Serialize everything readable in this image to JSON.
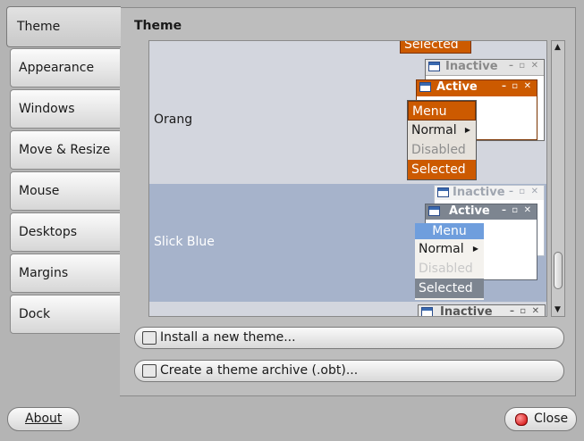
{
  "sidebar": {
    "tabs": [
      {
        "label": "Theme"
      },
      {
        "label": "Appearance"
      },
      {
        "label": "Windows"
      },
      {
        "label": "Move & Resize"
      },
      {
        "label": "Mouse"
      },
      {
        "label": "Desktops"
      },
      {
        "label": "Margins"
      },
      {
        "label": "Dock"
      }
    ]
  },
  "main": {
    "title": "Theme",
    "themes": [
      {
        "name": "Orang",
        "inactive": "Inactive",
        "active": "Active",
        "menu": "Menu",
        "normal": "Normal",
        "disabled": "Disabled",
        "selected": "Selected"
      },
      {
        "name": "Slick Blue",
        "inactive": "Inactive",
        "active": "Active",
        "menu": "Menu",
        "normal": "Normal",
        "disabled": "Disabled",
        "selected": "Selected",
        "row_selected": true
      },
      {
        "name": "",
        "inactive": "Inactive"
      }
    ],
    "partial_top": {
      "selected": "Selected"
    },
    "install_label": "Install a new theme...",
    "archive_label": "Create a theme archive (.obt)..."
  },
  "footer": {
    "about_label": "About",
    "close_label": "Close"
  },
  "colors": {
    "orang_accent": "#cc5a00",
    "slick_selected_row": "#a6b3cb",
    "slick_titlebar": "#7d8590",
    "slick_menu_header": "#6f9edd"
  }
}
